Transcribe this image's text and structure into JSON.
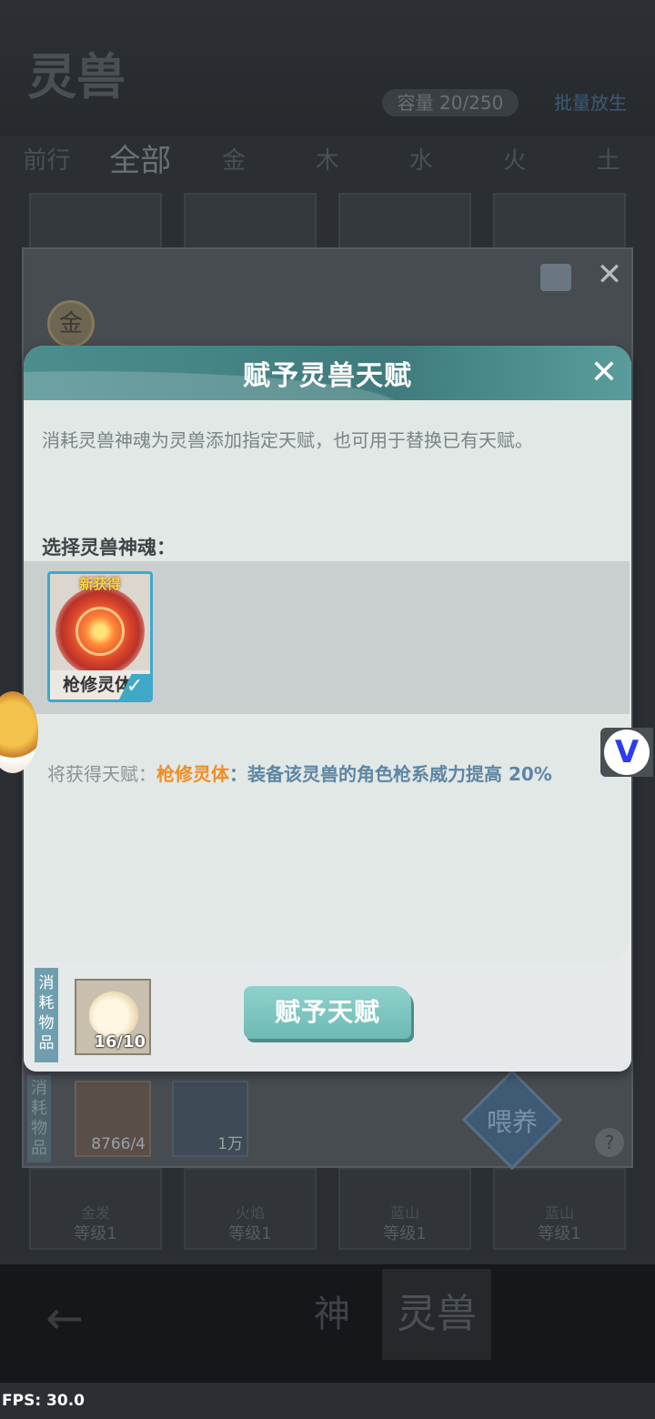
{
  "background": {
    "logo": "灵兽",
    "capacity": "容量 20/250",
    "batch_release": "批量放生",
    "tabs": [
      "前行",
      "全部",
      "金",
      "木",
      "水",
      "火",
      "土"
    ],
    "active_tab_index": 1,
    "bottom_cards": [
      {
        "name": "金发",
        "level": "等级1"
      },
      {
        "name": "火焰",
        "level": "等级1"
      },
      {
        "name": "蓝山",
        "level": "等级1"
      },
      {
        "name": "蓝山",
        "level": "等级1"
      }
    ],
    "nav": {
      "shen_label": "神",
      "ling_label": "灵兽"
    }
  },
  "panel": {
    "element_badge": "金",
    "consume_label": "消耗物品",
    "items": [
      {
        "count": "8766/4"
      },
      {
        "count": "1万"
      }
    ],
    "feed_label": "喂养",
    "help_icon": "question-icon"
  },
  "dialog": {
    "title": "赋予灵兽天赋",
    "close_icon": "close-icon",
    "description": "消耗灵兽神魂为灵兽添加指定天赋，也可用于替换已有天赋。",
    "select_label": "选择灵兽神魂：",
    "soul_card": {
      "badge": "新获得",
      "name": "枪修灵体",
      "selected": true
    },
    "gain": {
      "label": "将获得天赋：",
      "talent_name": "枪修灵体",
      "separator": "：",
      "effect": "装备该灵兽的角色枪系威力提高 20%"
    },
    "consume_label": "消耗物品",
    "consume_item": {
      "count": "16/10"
    },
    "grant_button": "赋予天赋"
  },
  "overlay": {
    "fps": "FPS: 30.0",
    "v_button": "V"
  },
  "colors": {
    "accent_teal": "#4d8d8e",
    "button": "#7fc6c0",
    "talent_orange": "#f18d24",
    "effect_blue": "#5e86a3"
  }
}
